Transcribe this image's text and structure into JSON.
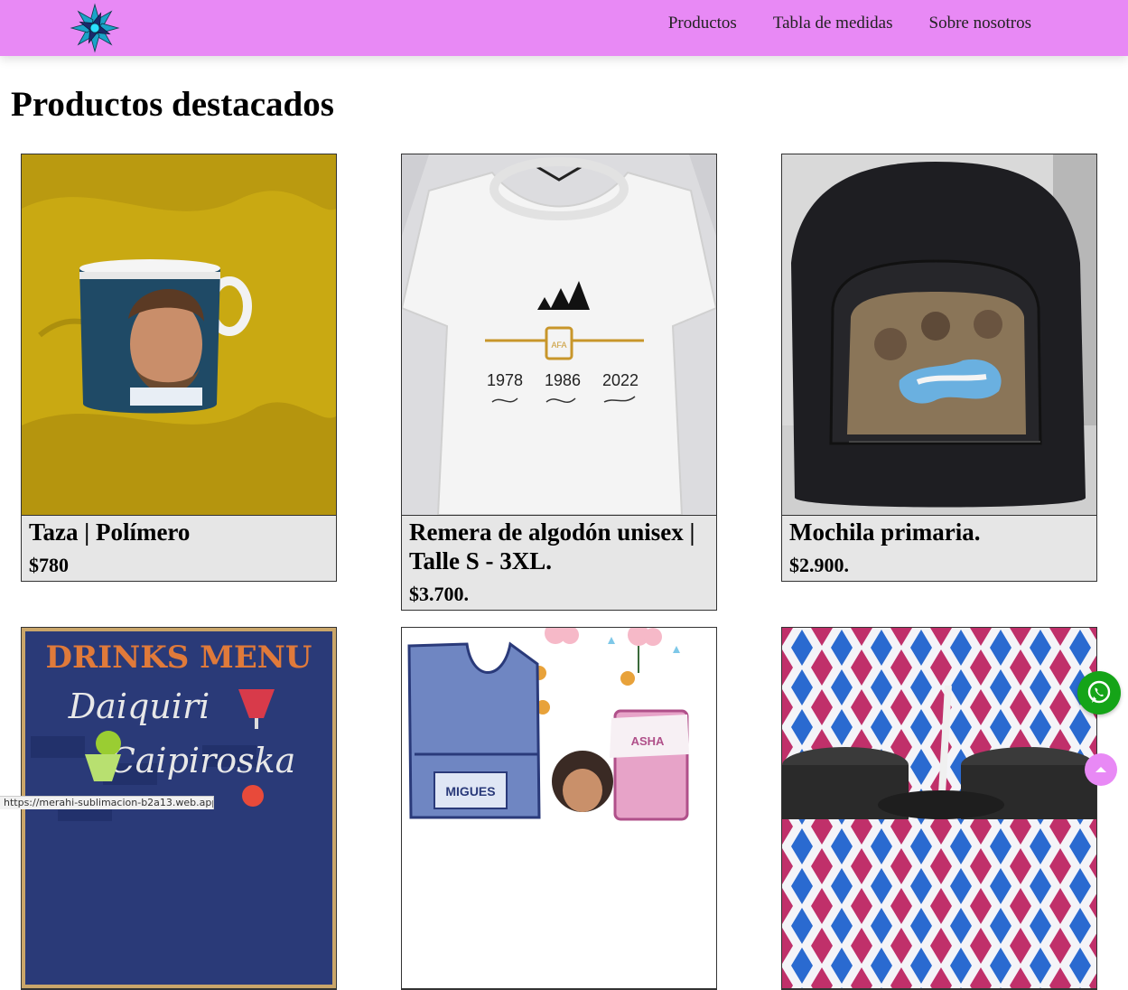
{
  "header": {
    "logo_icon": "flower-logo-icon",
    "nav": [
      {
        "label": "Productos"
      },
      {
        "label": "Tabla de medidas"
      },
      {
        "label": "Sobre nosotros"
      }
    ],
    "bg_color": "#e889f5"
  },
  "main": {
    "title": "Productos destacados",
    "products": [
      {
        "title": "Taza | Polímero",
        "price": "$780",
        "image": "mug-photo"
      },
      {
        "title": "Remera de algodón unisex | Talle S - 3XL.",
        "price": "$3.700.",
        "image": "tshirt-photo"
      },
      {
        "title": "Mochila primaria.",
        "price": "$2.900.",
        "image": "backpack-photo"
      },
      {
        "title": "",
        "price": "",
        "image": "drinks-menu-photo",
        "image_text": [
          "DRINKS MENU",
          "Daiquiri",
          "Caipiroska"
        ]
      },
      {
        "title": "",
        "price": "",
        "image": "school-apron-photo",
        "image_text": [
          "MIGUES",
          "ASHA"
        ]
      },
      {
        "title": "",
        "price": "",
        "image": "tumblers-photo"
      }
    ],
    "tshirt_print": {
      "years": [
        "1978",
        "1986",
        "2022"
      ],
      "badge": "AFA"
    }
  },
  "floating": {
    "whatsapp_icon": "whatsapp-icon",
    "whatsapp_color": "#15a418",
    "scroll_top_icon": "chevron-up-icon"
  },
  "status_bar": {
    "url": "https://merahi-sublimacion-b2a13.web.app/1"
  }
}
